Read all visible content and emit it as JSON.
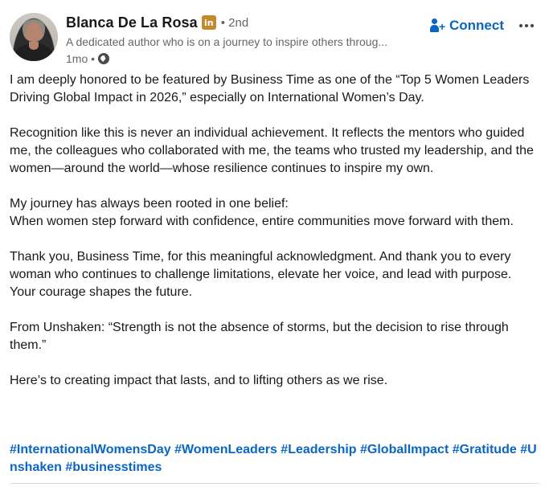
{
  "author": {
    "name": "Blanca De La Rosa",
    "badge": "in",
    "degree": "• 2nd",
    "headline": "A dedicated author who is on a journey to inspire others throug...",
    "time": "1mo •"
  },
  "actions": {
    "connect_label": "Connect",
    "connect_icon": "add-person-icon",
    "more_icon": "more-horizontal-icon"
  },
  "post": {
    "paragraphs": [
      "I am deeply honored to be featured by Business Time as one of the “Top 5 Women Leaders Driving Global Impact in 2026,” especially on International Women’s Day.",
      "Recognition like this is never an individual achievement. It reflects the mentors who guided me, the colleagues who collaborated with me, the teams who trusted my leadership, and the women—around the world—whose resilience continues to inspire my own.",
      "My journey has always been rooted in one belief:\nWhen women step forward with confidence, entire communities move forward with them.",
      "Thank you, Business Time, for this meaningful acknowledgment. And thank you to every woman who continues to challenge limitations, elevate her voice, and lead with purpose. Your courage shapes the future.",
      "From Unshaken: “Strength is not the absence of storms, but the decision to rise through them.”",
      "Here’s to creating impact that lasts, and to lifting others as we rise."
    ],
    "hashtags": [
      "#InternationalWomensDay",
      "#WomenLeaders",
      "#Leadership",
      "#GlobalImpact",
      "#Gratitude",
      "#Unshaken",
      "#businesstimes"
    ]
  },
  "colors": {
    "accent": "#0a66c2",
    "text": "#191919",
    "muted": "#666666",
    "badge": "#c28a2d"
  }
}
